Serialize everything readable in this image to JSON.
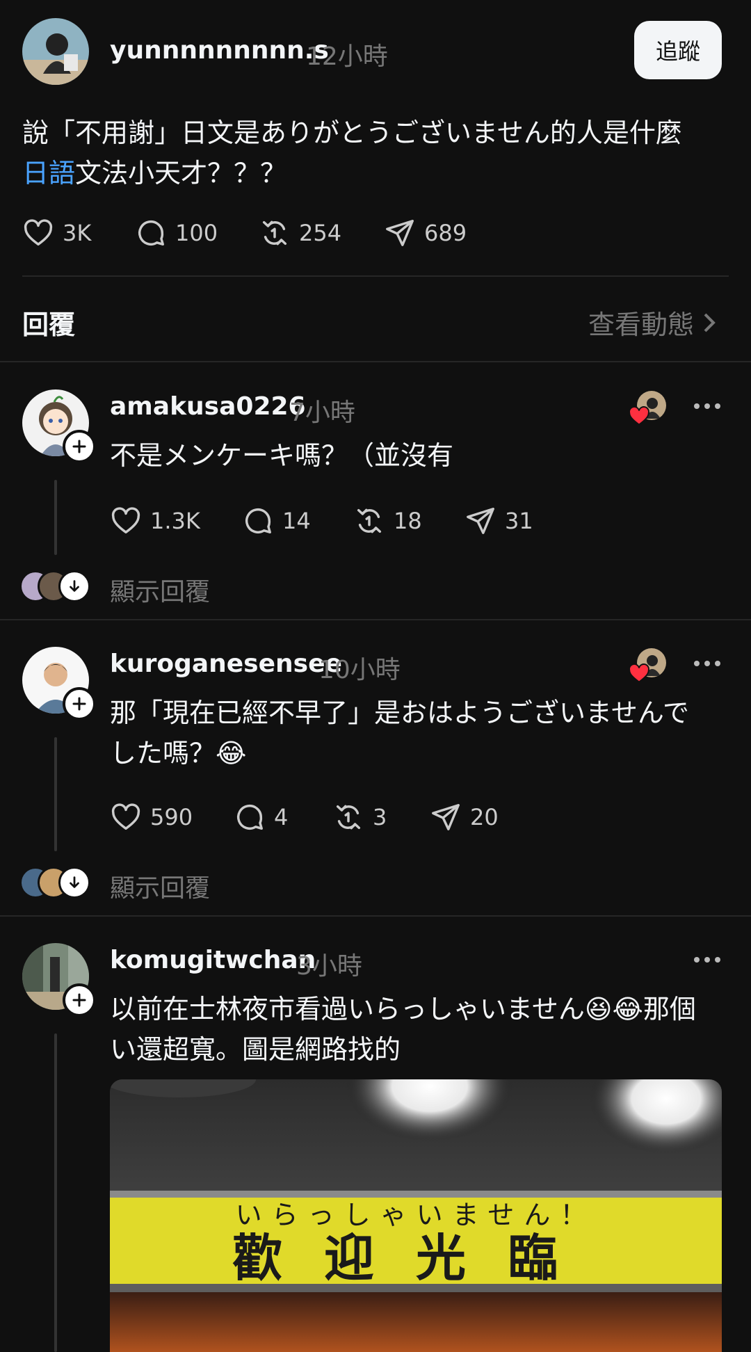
{
  "post": {
    "username": "yunnnnnnnnn.s",
    "time": "12小時",
    "follow_label": "追蹤",
    "text_line1": "說「不用謝」日文是ありがとうございません的人是什麼",
    "text_link": "日語",
    "text_line2_rest": "文法小天才？？？",
    "likes": "3K",
    "comments": "100",
    "reposts": "254",
    "shares": "689"
  },
  "replies_header": {
    "label": "回覆",
    "activity_link": "查看動態"
  },
  "replies": [
    {
      "username": "amakusa0226",
      "time": "7小時",
      "text": "不是メンケーキ嗎？（並沒有",
      "likes": "1.3K",
      "comments": "14",
      "reposts": "18",
      "shares": "31",
      "show_replies": "顯示回覆"
    },
    {
      "username": "kuroganesensee",
      "time": "10小時",
      "text_line1": "那「現在已經不早了」是おはようございませんで",
      "text_line2": "した嗎？😂",
      "likes": "590",
      "comments": "4",
      "reposts": "3",
      "shares": "20",
      "show_replies": "顯示回覆"
    },
    {
      "username": "komugitwchan",
      "time": "3小時",
      "text_line1": "以前在士林夜市看過いらっしゃいません😆😂那個",
      "text_line2": "い還超寬。圖是網路找的",
      "image_sign_kana": "いらっしゃいません！",
      "image_sign_kanji": "歡迎光臨"
    }
  ],
  "colors": {
    "background": "#101010",
    "text": "#f3f5f7",
    "muted": "#777777",
    "link": "#4aa3ff",
    "heart_red": "#ff3040"
  }
}
